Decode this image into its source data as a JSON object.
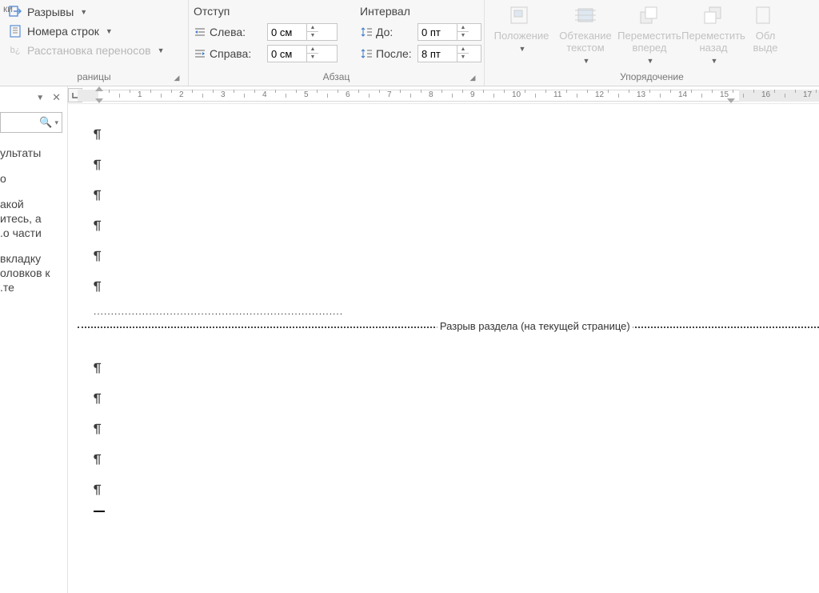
{
  "ribbon": {
    "pagesetup": {
      "label": "раницы",
      "fragment_top": "ки",
      "breaks": "Разрывы",
      "lineNumbers": "Номера строк",
      "hyphenation": "Расстановка переносов"
    },
    "paragraph": {
      "label": "Абзац",
      "indent_header": "Отступ",
      "spacing_header": "Интервал",
      "left_label": "Слева:",
      "right_label": "Справа:",
      "before_label": "До:",
      "after_label": "После:",
      "left_value": "0 см",
      "right_value": "0 см",
      "before_value": "0 пт",
      "after_value": "8 пт"
    },
    "arrange": {
      "label": "Упорядочение",
      "position": "Положение",
      "wrap": "Обтекание текстом",
      "forward": "Переместить вперед",
      "backward": "Переместить назад",
      "selection": "Обл выде"
    }
  },
  "nav": {
    "search_placeholder": "",
    "t1": "ультаты",
    "t2": "о",
    "t3a": "акой",
    "t3b": "итесь, а",
    "t3c": "о части.",
    "t4a": "вкладку",
    "t4b": "оловков к",
    "t4c": "те."
  },
  "ruler": {
    "numbers": [
      "1",
      "2",
      "3",
      "4",
      "5",
      "6",
      "7",
      "8",
      "9",
      "10",
      "11",
      "12",
      "13",
      "14",
      "15",
      "16",
      "17"
    ]
  },
  "doc": {
    "section_break_label": "Разрыв раздела (на текущей странице)"
  }
}
